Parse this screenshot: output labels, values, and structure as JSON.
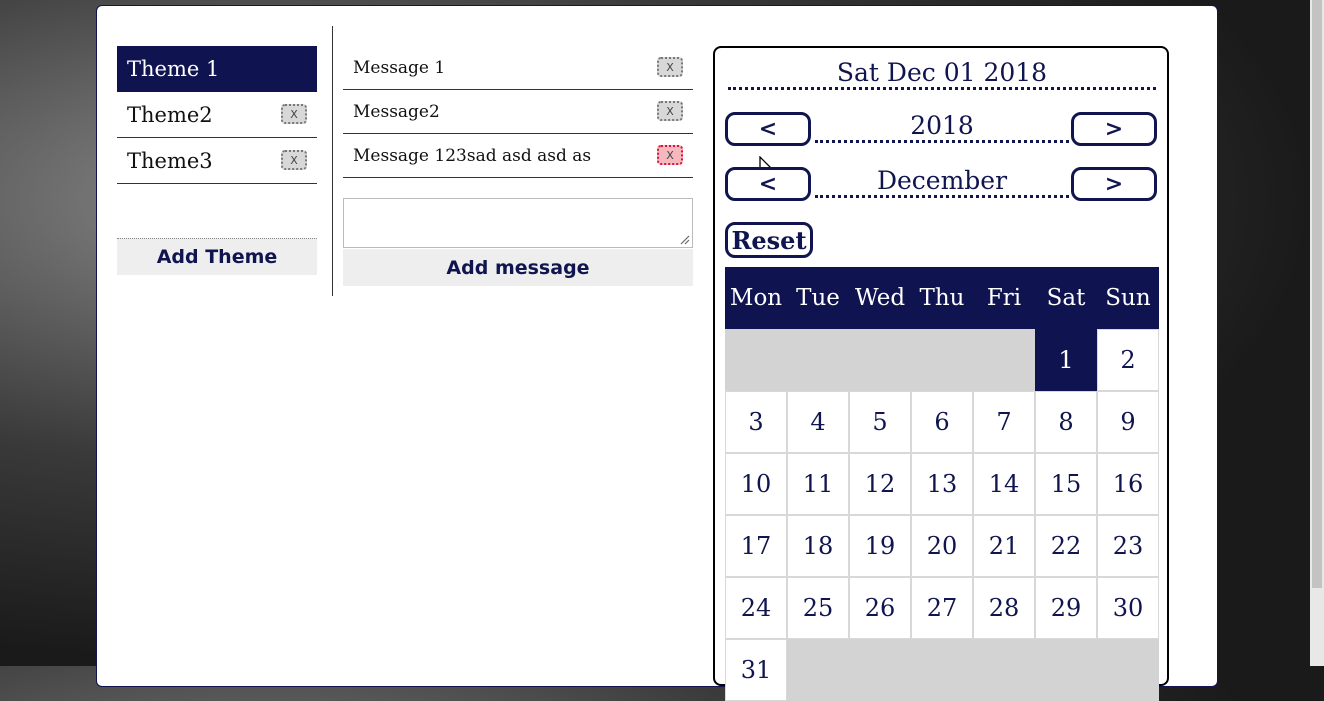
{
  "themes": {
    "items": [
      {
        "label": "Theme 1",
        "active": true
      },
      {
        "label": "Theme2",
        "active": false
      },
      {
        "label": "Theme3",
        "active": false
      }
    ],
    "delete_label": "X",
    "add_label": "Add Theme"
  },
  "messages": {
    "items": [
      {
        "text": "Message 1"
      },
      {
        "text": "Message2"
      },
      {
        "text": "Message 123sad asd asd as"
      }
    ],
    "delete_label": "X",
    "input_value": "",
    "add_label": "Add message"
  },
  "calendar": {
    "selected_date": "Sat Dec 01 2018",
    "year": "2018",
    "month": "December",
    "prev_label": "<",
    "next_label": ">",
    "reset_label": "Reset",
    "weekdays": [
      "Mon",
      "Tue",
      "Wed",
      "Thu",
      "Fri",
      "Sat",
      "Sun"
    ],
    "weeks": [
      [
        "",
        "",
        "",
        "",
        "",
        "1",
        "2"
      ],
      [
        "3",
        "4",
        "5",
        "6",
        "7",
        "8",
        "9"
      ],
      [
        "10",
        "11",
        "12",
        "13",
        "14",
        "15",
        "16"
      ],
      [
        "17",
        "18",
        "19",
        "20",
        "21",
        "22",
        "23"
      ],
      [
        "24",
        "25",
        "26",
        "27",
        "28",
        "29",
        "30"
      ],
      [
        "31",
        "",
        "",
        "",
        "",
        "",
        ""
      ]
    ],
    "selected_day": "1"
  },
  "colors": {
    "accent": "#0f1350",
    "hover_delete": "#f4b8be"
  }
}
